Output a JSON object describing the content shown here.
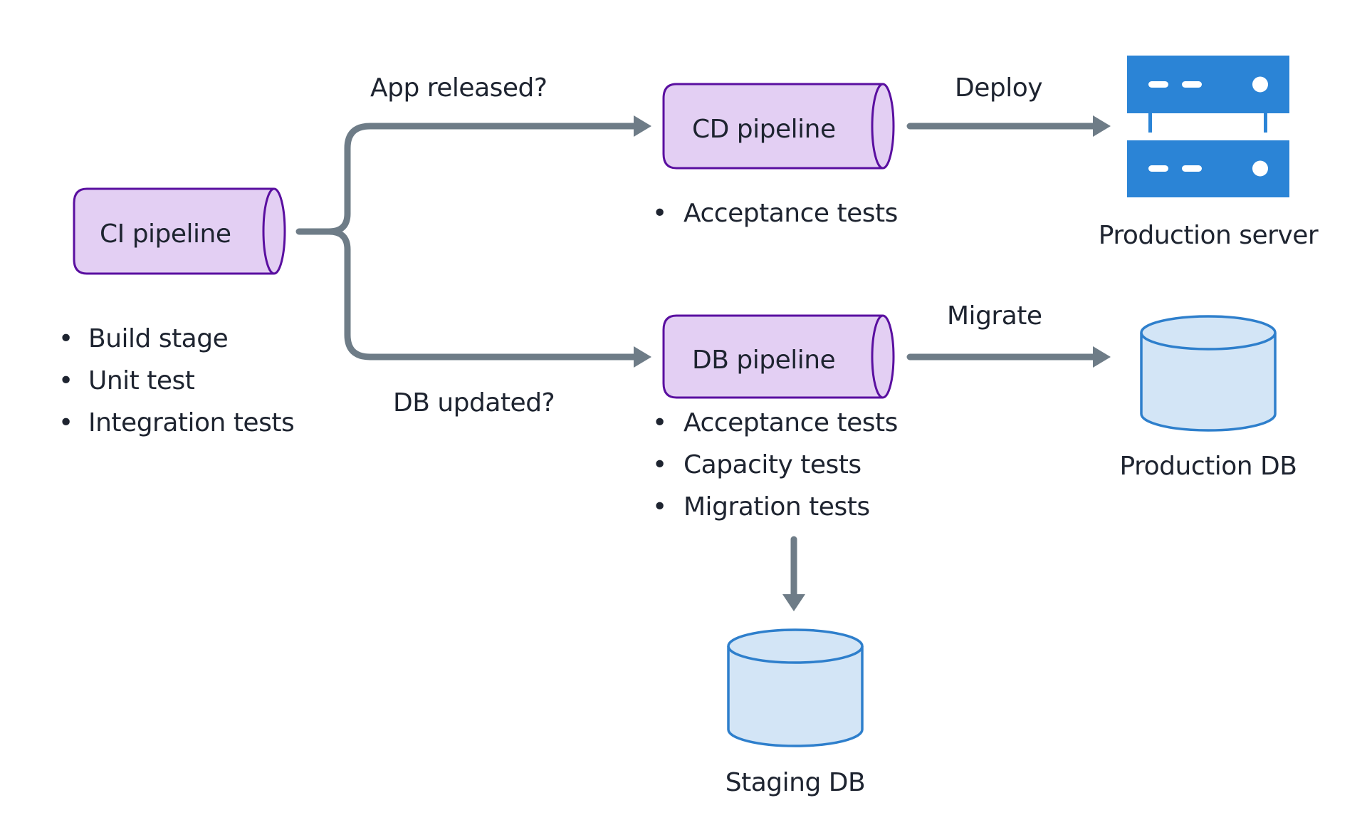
{
  "colors": {
    "pipeline_fill": "#e3cff3",
    "pipeline_stroke": "#5a0fa0",
    "arrow": "#6e7c87",
    "server": "#2b84d6",
    "db_fill": "#d3e5f6",
    "db_stroke": "#2e7fcc",
    "text": "#1e2430"
  },
  "nodes": {
    "ci_pipeline": {
      "label": "CI pipeline",
      "bullets": [
        "Build stage",
        "Unit test",
        "Integration tests"
      ]
    },
    "cd_pipeline": {
      "label": "CD pipeline",
      "bullets": [
        "Acceptance tests"
      ]
    },
    "db_pipeline": {
      "label": "DB pipeline",
      "bullets": [
        "Acceptance tests",
        "Capacity tests",
        "Migration tests"
      ]
    },
    "production_server": {
      "label": "Production server",
      "icon": "server-icon"
    },
    "production_db": {
      "label": "Production DB",
      "icon": "database-icon"
    },
    "staging_db": {
      "label": "Staging DB",
      "icon": "database-icon"
    }
  },
  "edges": {
    "ci_to_cd": {
      "label": "App released?"
    },
    "ci_to_db": {
      "label": "DB updated?"
    },
    "cd_to_server": {
      "label": "Deploy"
    },
    "db_to_proddb": {
      "label": "Migrate"
    },
    "db_to_staging": {
      "label": ""
    }
  },
  "bullet_glyph": "•"
}
